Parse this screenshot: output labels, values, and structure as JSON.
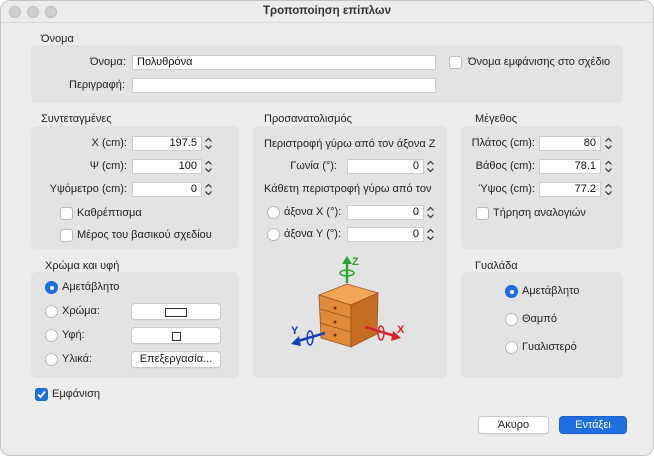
{
  "window": {
    "title": "Τροποποίηση επίπλων"
  },
  "name_section": {
    "title": "Όνομα",
    "name_label": "Όνομα:",
    "name_value": "Πολυθρόνα",
    "visible_name_label": "Όνομα εμφάνισης στο σχέδιο",
    "description_label": "Περιγραφή:",
    "description_value": ""
  },
  "coordinates": {
    "title": "Συντεταγμένες",
    "x_label": "X (cm):",
    "x_value": "197.5",
    "y_label": "Ψ (cm):",
    "y_value": "100",
    "elevation_label": "Υψόμετρο (cm):",
    "elevation_value": "0",
    "mirror_label": "Καθρέπτισμα",
    "base_plan_label": "Μέρος του βασικού σχεδίου"
  },
  "orientation": {
    "title": "Προσανατολισμός",
    "z_rotation_label": "Περιστροφή γύρω από τον άξονα Z",
    "angle_label": "Γωνία (°):",
    "angle_value": "0",
    "vertical_rotation_label": "Κάθετη περιστροφή γύρω από τον",
    "x_axis_label": "άξονα X (°):",
    "x_axis_value": "0",
    "y_axis_label": "άξονα Y (°):",
    "y_axis_value": "0",
    "axis_z": "Z",
    "axis_x": "X",
    "axis_y": "Y"
  },
  "size": {
    "title": "Μέγεθος",
    "width_label": "Πλάτος (cm):",
    "width_value": "80",
    "depth_label": "Βάθος (cm):",
    "depth_value": "78.1",
    "height_label": "Ύψος (cm):",
    "height_value": "77.2",
    "keep_proportions_label": "Τήρηση αναλογιών"
  },
  "color_texture": {
    "title": "Χρώμα και υφή",
    "unchanged_label": "Αμετάβλητο",
    "color_label": "Χρώμα:",
    "texture_label": "Υφή:",
    "materials_label": "Υλικά:",
    "edit_button": "Επεξεργασία..."
  },
  "gloss": {
    "title": "Γυαλάδα",
    "unchanged_label": "Αμετάβλητο",
    "matt_label": "Θαμπό",
    "shiny_label": "Γυαλιστερό"
  },
  "visible_label": "Εμφάνιση",
  "buttons": {
    "cancel": "Άκυρο",
    "ok": "Εντάξει"
  },
  "colors": {
    "accent": "#1f6fe0",
    "wood": "#e08a3c",
    "axis_x": "#d9232a",
    "axis_y": "#1a3fb5",
    "axis_z": "#2ea42e"
  }
}
